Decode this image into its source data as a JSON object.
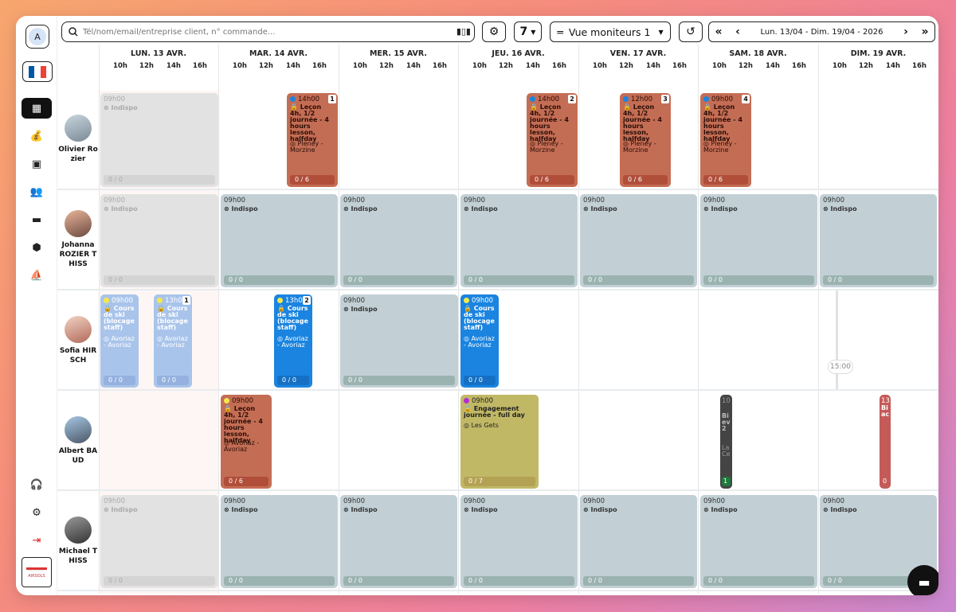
{
  "sidebar": {
    "avatar_initial": "A",
    "flag_colors": [
      "#0055A4",
      "#FFFFFF",
      "#EF4135"
    ],
    "icons": [
      "calendar-icon",
      "money-bag-icon",
      "contact-card-icon",
      "team-icon",
      "wallet-icon",
      "cubes-icon",
      "sailboat-icon"
    ],
    "bottom_icons": [
      "headset-icon",
      "gear-icon",
      "logout-icon"
    ],
    "logo_text": "AIRSOLS"
  },
  "topbar": {
    "search_placeholder": "Tél/nom/email/entreprise client, n° commande...",
    "days_value": "7",
    "view_label": "Vue moniteurs 1",
    "date_range": "Lun. 13/04 - Dim. 19/04 - 2026",
    "nav_first": "«",
    "nav_prev": "‹",
    "nav_next": "›",
    "nav_last": "»"
  },
  "days": [
    {
      "label": "LUN. 13 AVR."
    },
    {
      "label": "MAR. 14 AVR."
    },
    {
      "label": "MER. 15 AVR."
    },
    {
      "label": "JEU. 16 AVR."
    },
    {
      "label": "VEN. 17 AVR."
    },
    {
      "label": "SAM. 18 AVR."
    },
    {
      "label": "DIM. 19 AVR."
    }
  ],
  "hours": [
    "10h",
    "12h",
    "14h",
    "16h"
  ],
  "instructors": [
    {
      "name": "Olivier Ro zier"
    },
    {
      "name": "Johanna ROZIER T HISS"
    },
    {
      "name": "Sofia HIR SCH"
    },
    {
      "name": "Albert BA UD"
    },
    {
      "name": "Michael T HISS"
    }
  ],
  "common": {
    "indispo": "Indispo",
    "time_0900": "09h00",
    "zero": "0 / 0",
    "zero_six": "0 / 6",
    "zero_seven": "0 / 7",
    "lesson": "Leçon 4h, 1/2 journée - 4 hours lesson, halfday",
    "ski": "Cours de ski (blocage staff)",
    "engagement": "Engagement journée - full day",
    "pleney": "Pleney - Morzine",
    "avoriaz": "Avoriaz - Avoriaz",
    "lesgets": "Les Gets"
  },
  "events": [
    {
      "time": "14h00",
      "badge": "1"
    },
    {
      "time": "14h00",
      "badge": "2"
    },
    {
      "time": "12h00",
      "badge": "3"
    },
    {
      "time": "09h00",
      "badge": "4"
    },
    {
      "time": "09h00",
      "badge": ""
    },
    {
      "time": "13h00",
      "badge": "1"
    },
    {
      "time": "13h00",
      "badge": "2"
    },
    {
      "time": "09h00",
      "badge": ""
    }
  ],
  "partial": {
    "sam_time": "10",
    "sam_title": "Bi ev 2",
    "sam_loc": "La Ce",
    "sam_count": "1",
    "dim_time": "13",
    "dim_title": "Bi ac",
    "dim_count": "0"
  },
  "now_time": "15:00",
  "colors": {
    "lesson_brown": "#c46d55",
    "indispo_bluegrey": "#c2d0d6",
    "ski_light_blue": "#a9c4ea",
    "ski_blue": "#1a84e0",
    "engagement_olive": "#c1b866"
  }
}
